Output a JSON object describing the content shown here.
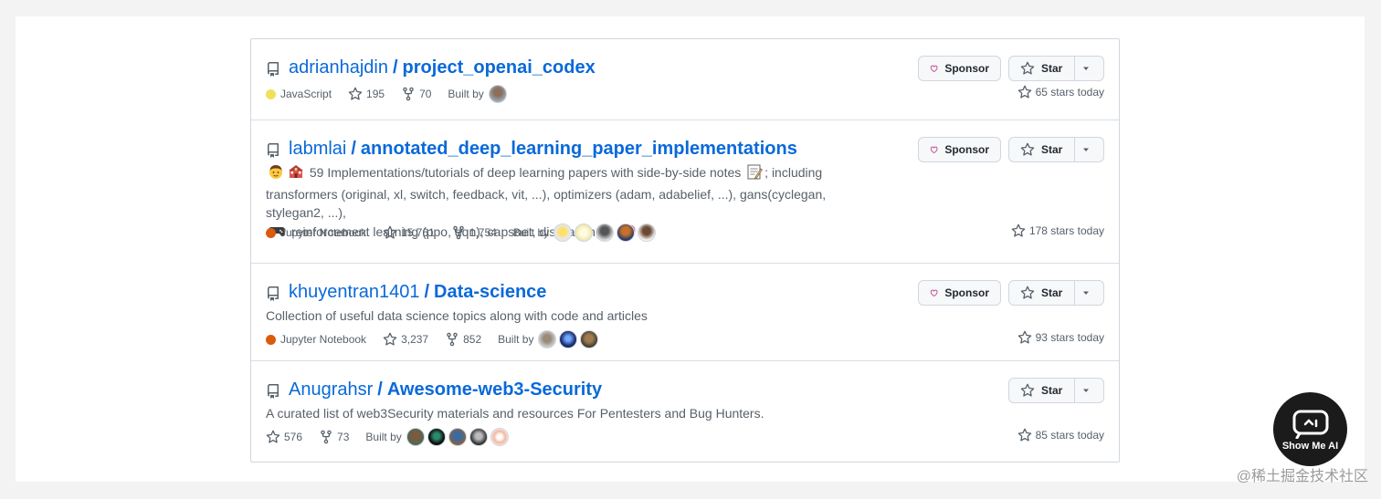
{
  "repos": [
    {
      "owner": "adrianhajdin",
      "name": "project_openai_codex",
      "description": [],
      "language": "JavaScript",
      "language_color": "#f1e05a",
      "stars": "195",
      "forks": "70",
      "built_by_label": "Built by",
      "sponsor": true,
      "stars_today": "65 stars today"
    },
    {
      "owner": "labmlai",
      "name": "annotated_deep_learning_paper_implementations",
      "description": [
        "59 Implementations/tutorials of deep learning papers with side-by-side notes",
        "; including",
        "transformers (original, xl, switch, feedback, vit, ...), optimizers (adam, adabelief, ...), gans(cyclegan, stylegan2, ...),",
        "reinforcement learning (ppo, dqn), capsnet, distillation, ..."
      ],
      "language": "Jupyter Notebook",
      "language_color": "#DA5B0B",
      "stars": "15,761",
      "forks": "1,754",
      "built_by_label": "Built by",
      "sponsor": true,
      "stars_today": "178 stars today"
    },
    {
      "owner": "khuyentran1401",
      "name": "Data-science",
      "description": [
        "Collection of useful data science topics along with code and articles"
      ],
      "language": "Jupyter Notebook",
      "language_color": "#DA5B0B",
      "stars": "3,237",
      "forks": "852",
      "built_by_label": "Built by",
      "sponsor": true,
      "stars_today": "93 stars today"
    },
    {
      "owner": "Anugrahsr",
      "name": "Awesome-web3-Security",
      "description": [
        "A curated list of web3Security materials and resources For Pentesters and Bug Hunters."
      ],
      "language": "",
      "language_color": "",
      "stars": "576",
      "forks": "73",
      "built_by_label": "Built by",
      "sponsor": false,
      "stars_today": "85 stars today"
    }
  ],
  "buttons": {
    "sponsor_label": "Sponsor",
    "star_label": "Star"
  },
  "separator": "/",
  "watermark": {
    "text": "Show Me AI"
  },
  "site_tag": "@稀土掘金技术社区",
  "colors": {
    "link": "#0969da",
    "heart": "#bf3989",
    "border": "#d0d7de"
  }
}
